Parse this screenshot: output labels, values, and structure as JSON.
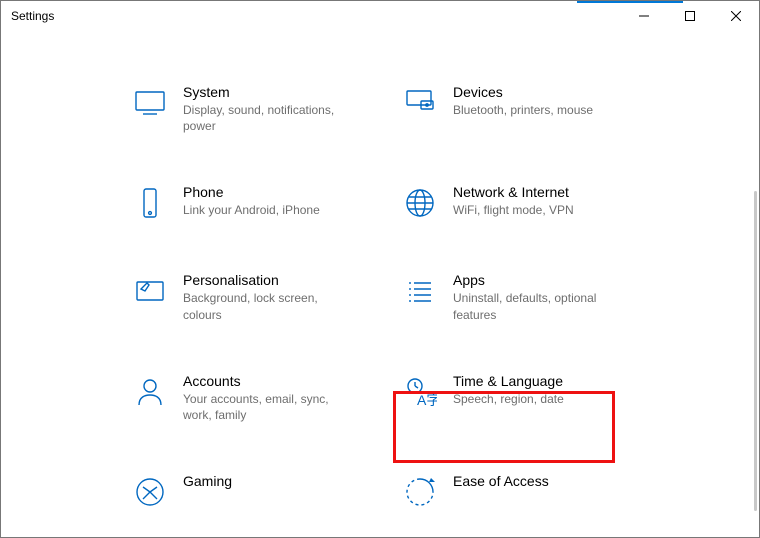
{
  "window": {
    "title": "Settings"
  },
  "categories": [
    {
      "id": "system",
      "title": "System",
      "desc": "Display, sound, notifications, power"
    },
    {
      "id": "devices",
      "title": "Devices",
      "desc": "Bluetooth, printers, mouse"
    },
    {
      "id": "phone",
      "title": "Phone",
      "desc": "Link your Android, iPhone"
    },
    {
      "id": "network",
      "title": "Network & Internet",
      "desc": "WiFi, flight mode, VPN"
    },
    {
      "id": "personalisation",
      "title": "Personalisation",
      "desc": "Background, lock screen, colours"
    },
    {
      "id": "apps",
      "title": "Apps",
      "desc": "Uninstall, defaults, optional features"
    },
    {
      "id": "accounts",
      "title": "Accounts",
      "desc": "Your accounts, email, sync, work, family"
    },
    {
      "id": "time-language",
      "title": "Time & Language",
      "desc": "Speech, region, date"
    },
    {
      "id": "gaming",
      "title": "Gaming",
      "desc": ""
    },
    {
      "id": "ease-of-access",
      "title": "Ease of Access",
      "desc": ""
    }
  ],
  "highlighted_category": "time-language",
  "colors": {
    "accent": "#0067c0",
    "highlight_border": "#e11"
  }
}
